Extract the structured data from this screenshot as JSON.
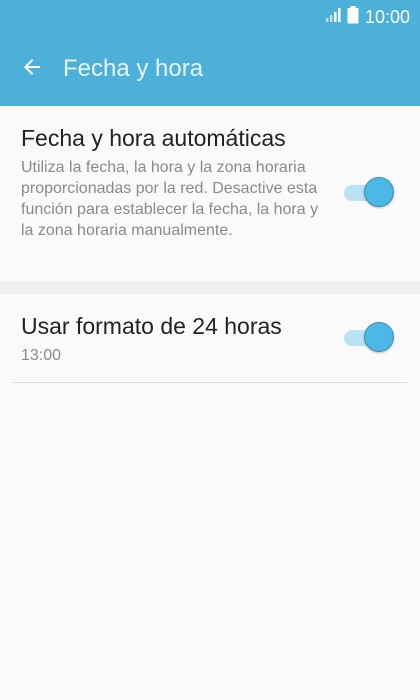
{
  "status_bar": {
    "time": "10:00",
    "signal_icon": "cellular-signal-icon",
    "battery_icon": "battery-icon"
  },
  "app_bar": {
    "title": "Fecha y hora",
    "back_icon": "arrow-back-icon"
  },
  "settings": {
    "auto_datetime": {
      "title": "Fecha y hora automáticas",
      "description": "Utiliza la fecha, la hora y la zona horaria proporcionadas por la red. Desactive esta función para establecer la fecha, la hora y la zona horaria manualmente.",
      "enabled": true
    },
    "format_24h": {
      "title": "Usar formato de 24 horas",
      "subtitle": "13:00",
      "enabled": true
    }
  },
  "colors": {
    "accent": "#4db0d9",
    "toggle_knob": "#4db8e8",
    "toggle_track": "#b9e3f4",
    "background": "#fafafa",
    "section_gap": "#efefef"
  }
}
